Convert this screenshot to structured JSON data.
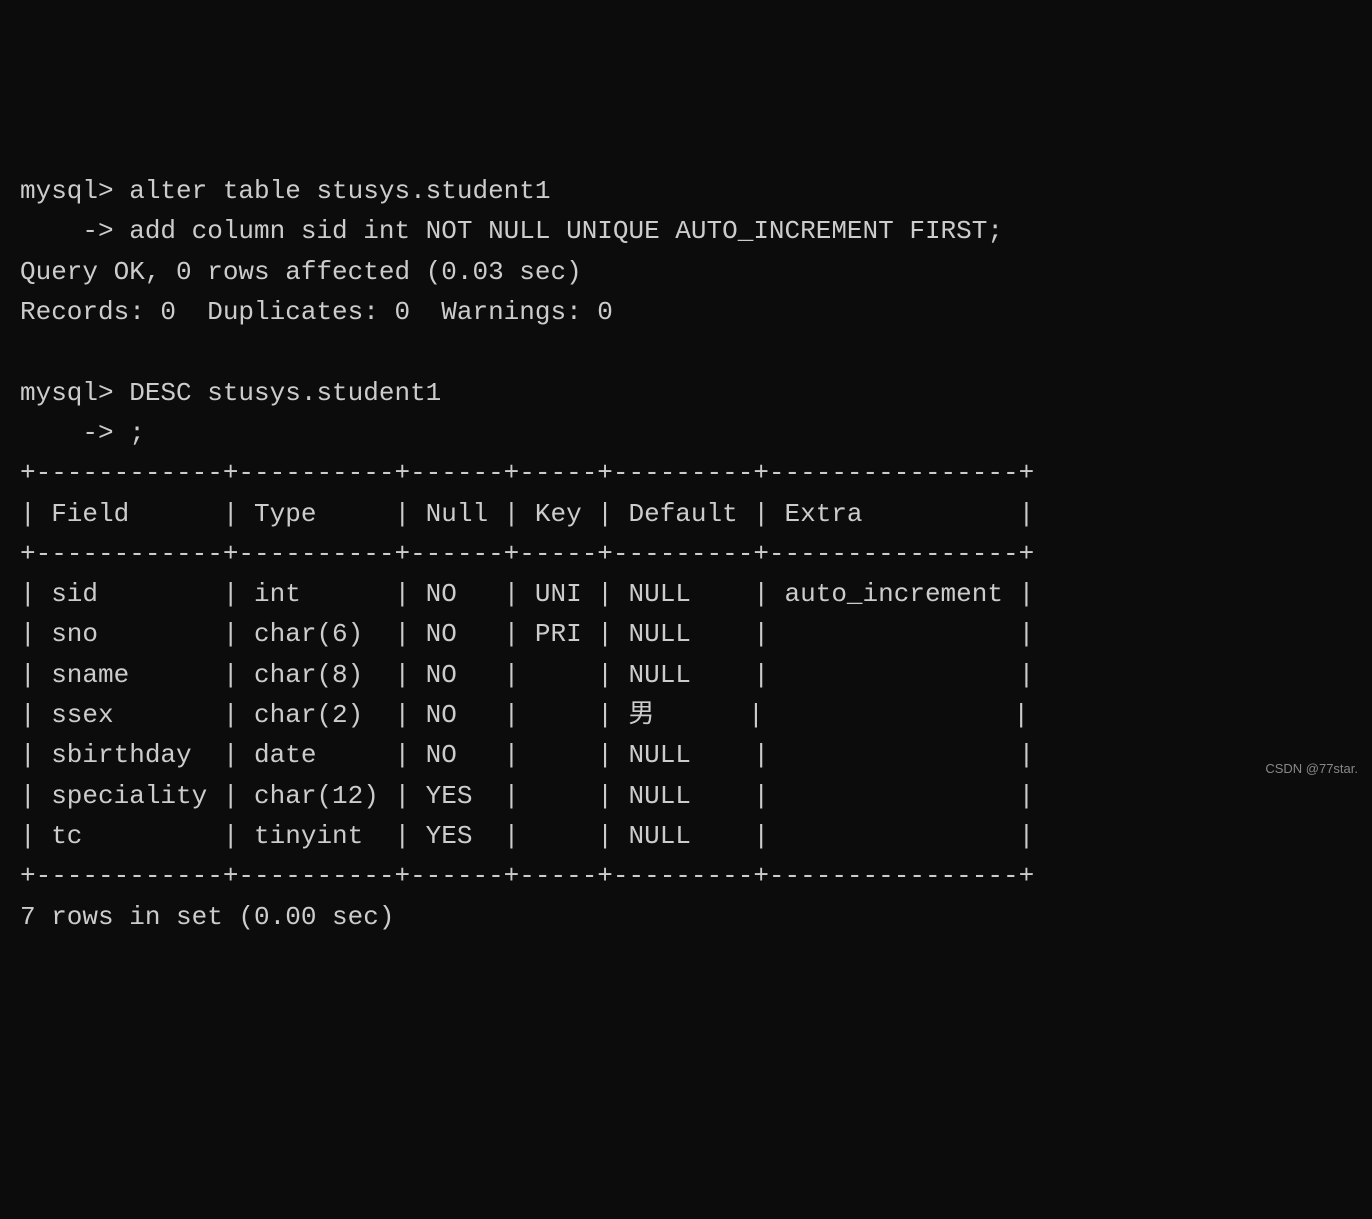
{
  "chart_data": {
    "type": "table",
    "title": "DESC stusys.student1",
    "columns": [
      "Field",
      "Type",
      "Null",
      "Key",
      "Default",
      "Extra"
    ],
    "rows": [
      [
        "sid",
        "int",
        "NO",
        "UNI",
        "NULL",
        "auto_increment"
      ],
      [
        "sno",
        "char(6)",
        "NO",
        "PRI",
        "NULL",
        ""
      ],
      [
        "sname",
        "char(8)",
        "NO",
        "",
        "NULL",
        ""
      ],
      [
        "ssex",
        "char(2)",
        "NO",
        "",
        "男",
        ""
      ],
      [
        "sbirthday",
        "date",
        "NO",
        "",
        "NULL",
        ""
      ],
      [
        "speciality",
        "char(12)",
        "YES",
        "",
        "NULL",
        ""
      ],
      [
        "tc",
        "tinyint",
        "YES",
        "",
        "NULL",
        ""
      ]
    ]
  },
  "commands": {
    "prompt": "mysql>",
    "cont": "    ->",
    "cmd1_line1": "alter table stusys.student1",
    "cmd1_line2": "add column sid int NOT NULL UNIQUE AUTO_INCREMENT FIRST;",
    "result1_line1": "Query OK, 0 rows affected (0.03 sec)",
    "result1_line2": "Records: 0  Duplicates: 0  Warnings: 0",
    "cmd2_line1": "DESC stusys.student1",
    "cmd2_line2": ";",
    "footer": "7 rows in set (0.00 sec)"
  },
  "table": {
    "col_widths": {
      "field": 12,
      "type": 10,
      "null": 6,
      "key": 5,
      "default": 9,
      "extra": 16
    }
  },
  "watermark": "CSDN @77star."
}
